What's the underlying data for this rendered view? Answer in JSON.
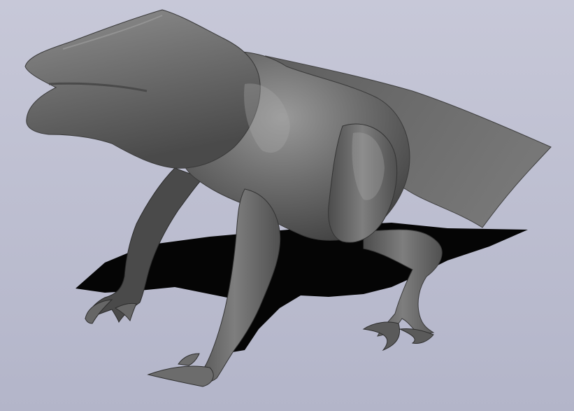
{
  "scene": {
    "background_top": "#c7c8d8",
    "background_bottom": "#b3b5c9",
    "model_base": "#6a6a6a",
    "model_dark": "#3a3a3a",
    "model_light": "#9c9c9c",
    "shadow": "#050505"
  }
}
